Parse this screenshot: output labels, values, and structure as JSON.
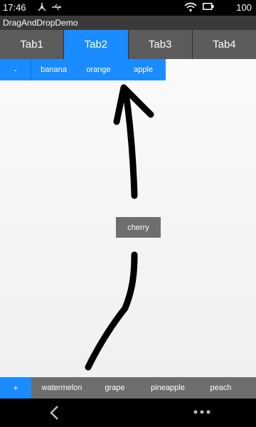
{
  "status_bar": {
    "time": "17:46",
    "battery": "100",
    "icons": [
      "usb-debug-icon",
      "usb-icon",
      "wifi-icon",
      "battery-icon"
    ]
  },
  "app": {
    "title": "DragAndDropDemo"
  },
  "tabs": [
    {
      "label": "Tab1",
      "active": false
    },
    {
      "label": "Tab2",
      "active": true
    },
    {
      "label": "Tab3",
      "active": false
    },
    {
      "label": "Tab4",
      "active": false
    }
  ],
  "top_row": {
    "button_label": "-",
    "items": [
      "banana",
      "orange",
      "apple"
    ]
  },
  "dragged_item": {
    "label": "cherry"
  },
  "bottom_row": {
    "button_label": "+",
    "items": [
      "watermelon",
      "grape",
      "pineapple",
      "peach"
    ]
  },
  "nav_bar": {
    "icons": [
      "back-icon",
      "more-icon"
    ]
  },
  "colors": {
    "accent": "#1a8cff",
    "chip_gray": "#6e6e6e",
    "tab_gray": "#5c5c5c"
  }
}
